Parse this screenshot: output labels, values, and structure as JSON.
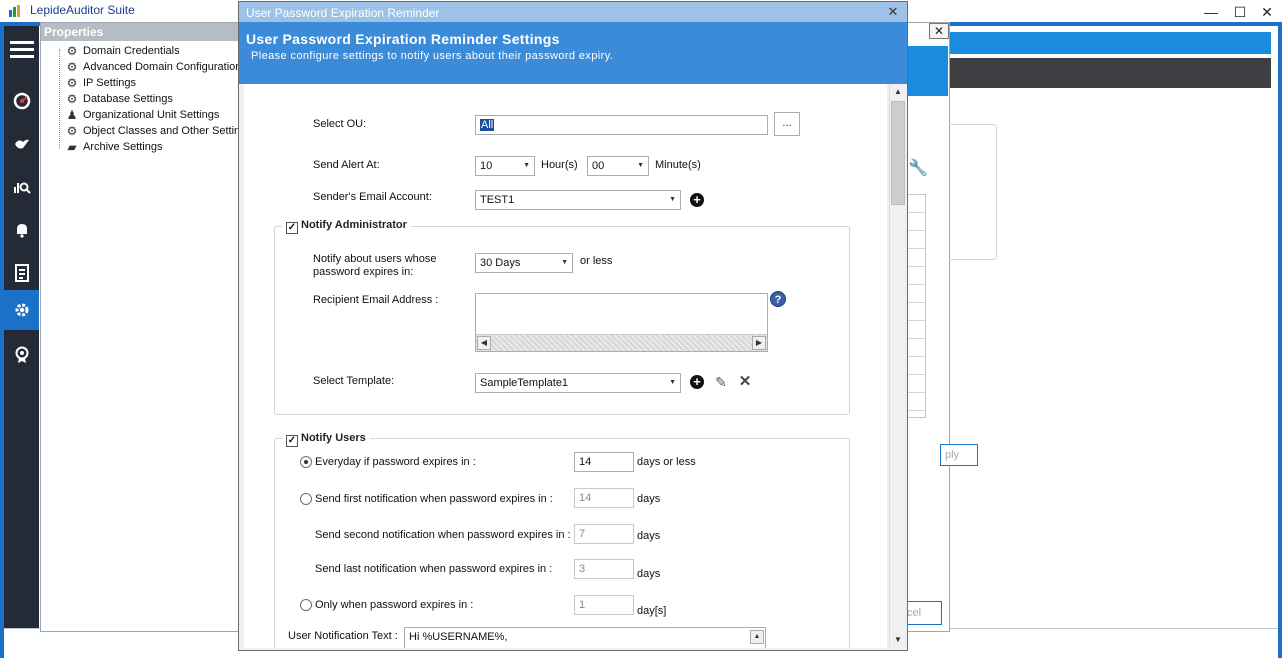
{
  "app": {
    "title": "LepideAuditor Suite",
    "window_controls": {
      "minimize": "—",
      "maximize": "☐",
      "close": "✕"
    }
  },
  "leftbar": {
    "items": [
      {
        "icon": "menu-icon"
      },
      {
        "icon": "dashboard-icon"
      },
      {
        "icon": "bird-icon"
      },
      {
        "icon": "audit-search-icon"
      },
      {
        "icon": "bell-icon"
      },
      {
        "icon": "report-icon"
      },
      {
        "icon": "settings-gear-icon",
        "active": true
      },
      {
        "icon": "license-badge-icon"
      }
    ]
  },
  "properties": {
    "title": "Properties",
    "close_label": "✕",
    "tree": [
      {
        "label": "Domain Credentials",
        "icon": "gear-icon"
      },
      {
        "label": "Advanced Domain Configuration",
        "icon": "gear-icon"
      },
      {
        "label": "IP Settings",
        "icon": "gear-icon"
      },
      {
        "label": "Database Settings",
        "icon": "gear-icon"
      },
      {
        "label": "Organizational Unit Settings",
        "icon": "ou-icon"
      },
      {
        "label": "Object Classes and Other Settin",
        "icon": "gear-icon"
      },
      {
        "label": "Archive Settings",
        "icon": "folder-icon"
      }
    ],
    "apply_partial": "ply",
    "cancel_partial": "cel"
  },
  "dialog": {
    "window_title": "User Password Expiration Reminder",
    "close_label": "✕",
    "header_title": "User Password Expiration Reminder Settings",
    "header_subtitle": "Please configure settings to notify users about their password expiry.",
    "select_ou": {
      "label": "Select OU:",
      "value": "All",
      "browse_label": "..."
    },
    "send_alert": {
      "label": "Send Alert At:",
      "hour_value": "10",
      "hour_unit": "Hour(s)",
      "minute_value": "00",
      "minute_unit": "Minute(s)"
    },
    "sender_email": {
      "label": "Sender's Email Account:",
      "value": "TEST1"
    },
    "notify_admin": {
      "legend": "Notify Administrator",
      "checked": true,
      "expires_label_1": "Notify about users whose",
      "expires_label_2": "password expires in:",
      "expires_value": "30 Days",
      "expires_suffix": "or less",
      "recipient_label": "Recipient Email Address :",
      "recipient_value": "",
      "template_label": "Select Template:",
      "template_value": "SampleTemplate1"
    },
    "notify_users": {
      "legend": "Notify Users",
      "checked": true,
      "options": [
        {
          "label": "Everyday if password expires in :",
          "value": "14",
          "suffix": "days or less",
          "selected": true,
          "disabled": false
        },
        {
          "label": "Send first notification when password expires in :",
          "value": "14",
          "suffix": "days",
          "selected": false,
          "disabled": true
        },
        {
          "label": "Send second notification when password expires in :",
          "value": "7",
          "suffix": "days",
          "disabled": true
        },
        {
          "label": "Send last notification when password expires in :",
          "value": "3",
          "suffix": "days",
          "disabled": true
        },
        {
          "label": "Only when password expires in :",
          "value": "1",
          "suffix": "day[s]",
          "selected": false,
          "disabled": true
        }
      ],
      "notification_text_label": "User Notification Text :",
      "notification_text_value": "Hi %USERNAME%,"
    }
  }
}
